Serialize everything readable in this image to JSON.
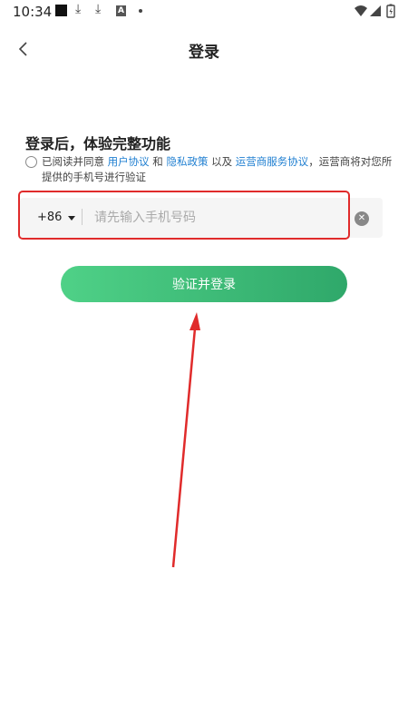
{
  "status_bar": {
    "time": "10:34"
  },
  "header": {
    "title": "登录",
    "back_icon": "chevron-left-icon"
  },
  "login": {
    "heading": "登录后，体验完整功能",
    "agreement": {
      "prefix": "已阅读并同意 ",
      "link_user": "用户协议",
      "and": " 和 ",
      "link_privacy": "隐私政策",
      "and2": " 以及 ",
      "link_carrier": "运营商服务协议",
      "suffix": "，运营商将对您所提供的手机号进行验证"
    },
    "country_code": "+86",
    "phone_placeholder": "请先输入手机号码",
    "submit_label": "验证并登录"
  },
  "colors": {
    "accent_green": "#3cc17a",
    "link_blue": "#1f7fd1",
    "annotation_red": "#e02b2b"
  }
}
